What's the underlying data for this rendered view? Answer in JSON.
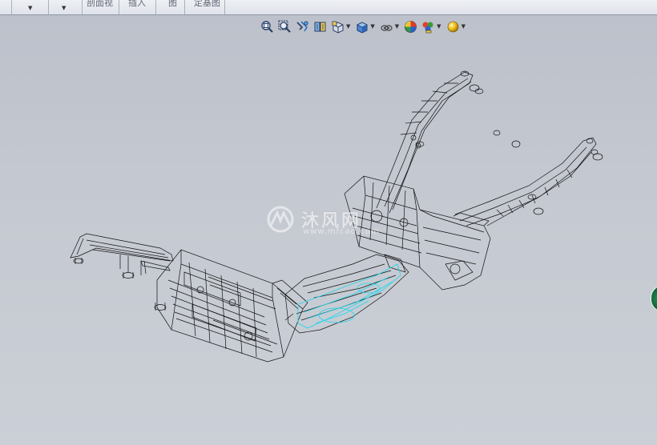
{
  "command_manager": {
    "groups": [
      {
        "label": "",
        "has_dropdown": true
      },
      {
        "label": "",
        "has_dropdown": true
      },
      {
        "label": "剖面视",
        "has_dropdown": false
      },
      {
        "label": "插入",
        "has_dropdown": false
      },
      {
        "label": "图",
        "has_dropdown": false
      },
      {
        "label": "定基图",
        "has_dropdown": false
      }
    ]
  },
  "heads_up_toolbar": {
    "tools": [
      {
        "icon": "zoom-to-fit-icon",
        "dropdown": false
      },
      {
        "icon": "zoom-to-area-icon",
        "dropdown": false
      },
      {
        "icon": "previous-view-icon",
        "dropdown": false
      },
      {
        "icon": "section-view-icon",
        "dropdown": false
      },
      {
        "icon": "view-orientation-icon",
        "dropdown": true
      },
      {
        "icon": "display-style-icon",
        "dropdown": true
      },
      {
        "icon": "hide-show-items-icon",
        "dropdown": true
      },
      {
        "icon": "edit-appearance-icon",
        "dropdown": false
      },
      {
        "icon": "apply-scene-icon",
        "dropdown": true
      },
      {
        "icon": "view-settings-icon",
        "dropdown": true
      }
    ]
  },
  "watermark": {
    "big": "沐风网",
    "small": "www.mfcad.com"
  },
  "colors": {
    "viewport_top": "#bcc0ca",
    "viewport_bottom": "#cbcfd6",
    "wireframe": "#111111",
    "highlight": "#19d7ee"
  }
}
